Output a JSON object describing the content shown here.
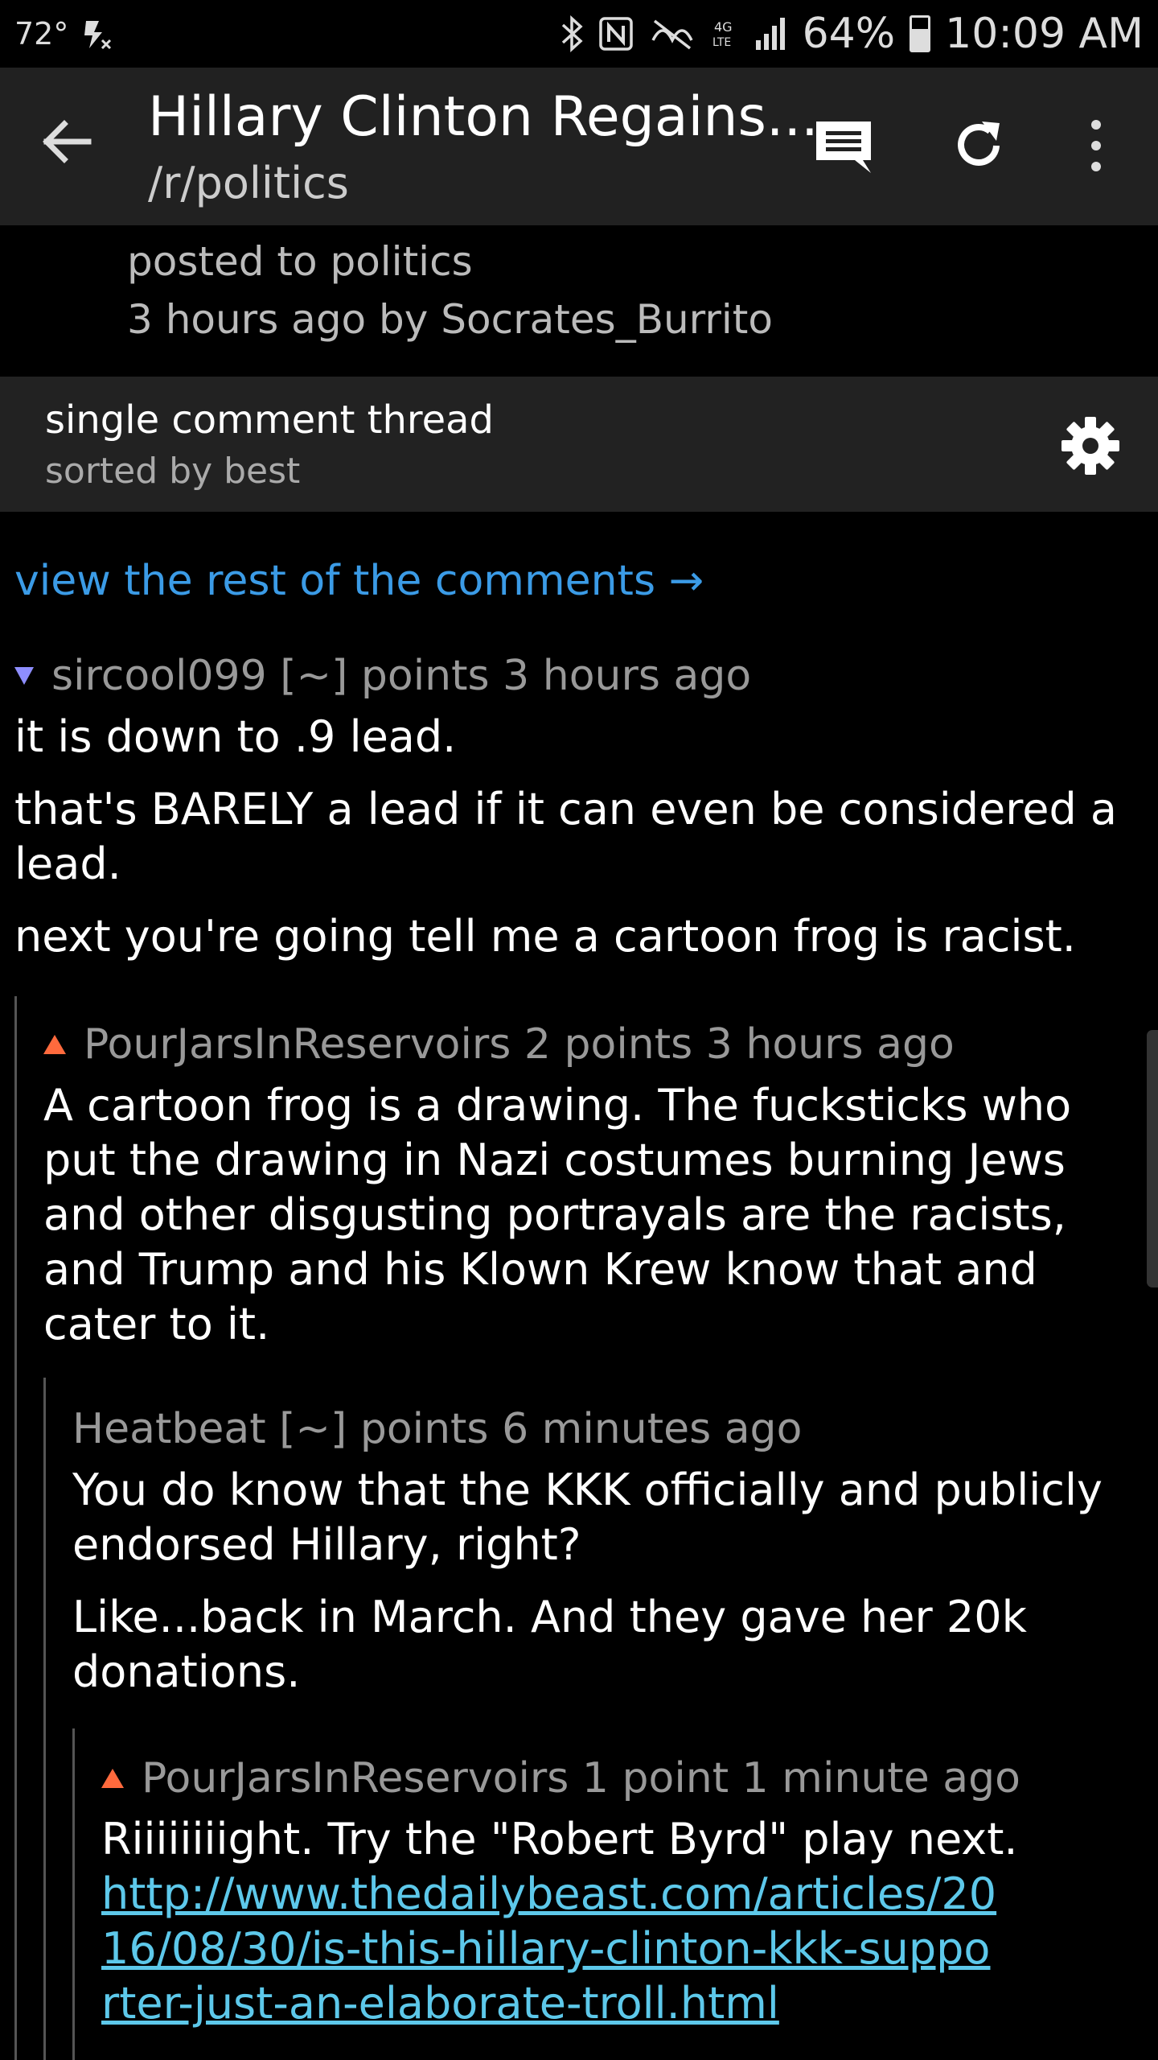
{
  "statusbar": {
    "temperature": "72°",
    "battery": "64%",
    "battery_level": 0.64,
    "time": "10:09 AM",
    "icons": [
      "no-flash-icon",
      "bluetooth-icon",
      "nfc-icon",
      "mute-icon",
      "4g-lte-icon",
      "signal-icon",
      "battery-icon"
    ]
  },
  "toolbar": {
    "title": "Hillary Clinton Regains...",
    "subreddit": "/r/politics",
    "icons": [
      "back-arrow-icon",
      "comment-icon",
      "refresh-icon",
      "overflow-menu-icon"
    ]
  },
  "post": {
    "posted_to": "posted to politics",
    "byline": "3 hours ago by Socrates_Burrito"
  },
  "thread": {
    "mode": "single comment thread",
    "sort": "sorted by best",
    "view_rest": "view the rest of the comments →"
  },
  "comments": [
    {
      "author": "sircool099",
      "score": "[~] points",
      "time": "3 hours ago",
      "vote": "down",
      "paragraphs": [
        "it is down to .9 lead.",
        "that's BARELY a lead if it can even be considered a lead.",
        "next you're going tell me a cartoon frog is racist."
      ]
    },
    {
      "author": "PourJarsInReservoirs",
      "score": "2 points",
      "time": "3 hours ago",
      "vote": "up",
      "paragraphs": [
        "A cartoon frog is a drawing. The fucksticks who put the drawing in Nazi costumes burning Jews and other disgusting portrayals are the racists, and Trump and his Klown Krew know that and cater to it."
      ]
    },
    {
      "author": "Heatbeat",
      "score": "[~] points",
      "time": "6 minutes ago",
      "vote": "none",
      "paragraphs": [
        "You do know that the KKK officially and publicly endorsed Hillary, right?",
        "Like...back in March. And they gave her 20k donations."
      ]
    },
    {
      "author": "PourJarsInReservoirs",
      "score": "1 point",
      "time": "1 minute ago",
      "vote": "up",
      "paragraphs": [
        "Riiiiiiiight. Try the \"Robert Byrd\" play next."
      ],
      "link": "http://www.thedailybeast.com/articles/2016/08/30/is-this-hillary-clinton-kkk-supporter-just-an-elaborate-troll.html"
    }
  ],
  "colors": {
    "link": "#3b9be6",
    "inline_link": "#5dc8ea",
    "upvote": "#ff6a3d",
    "downvote": "#8e8eff",
    "toolbar_bg": "#212121"
  }
}
